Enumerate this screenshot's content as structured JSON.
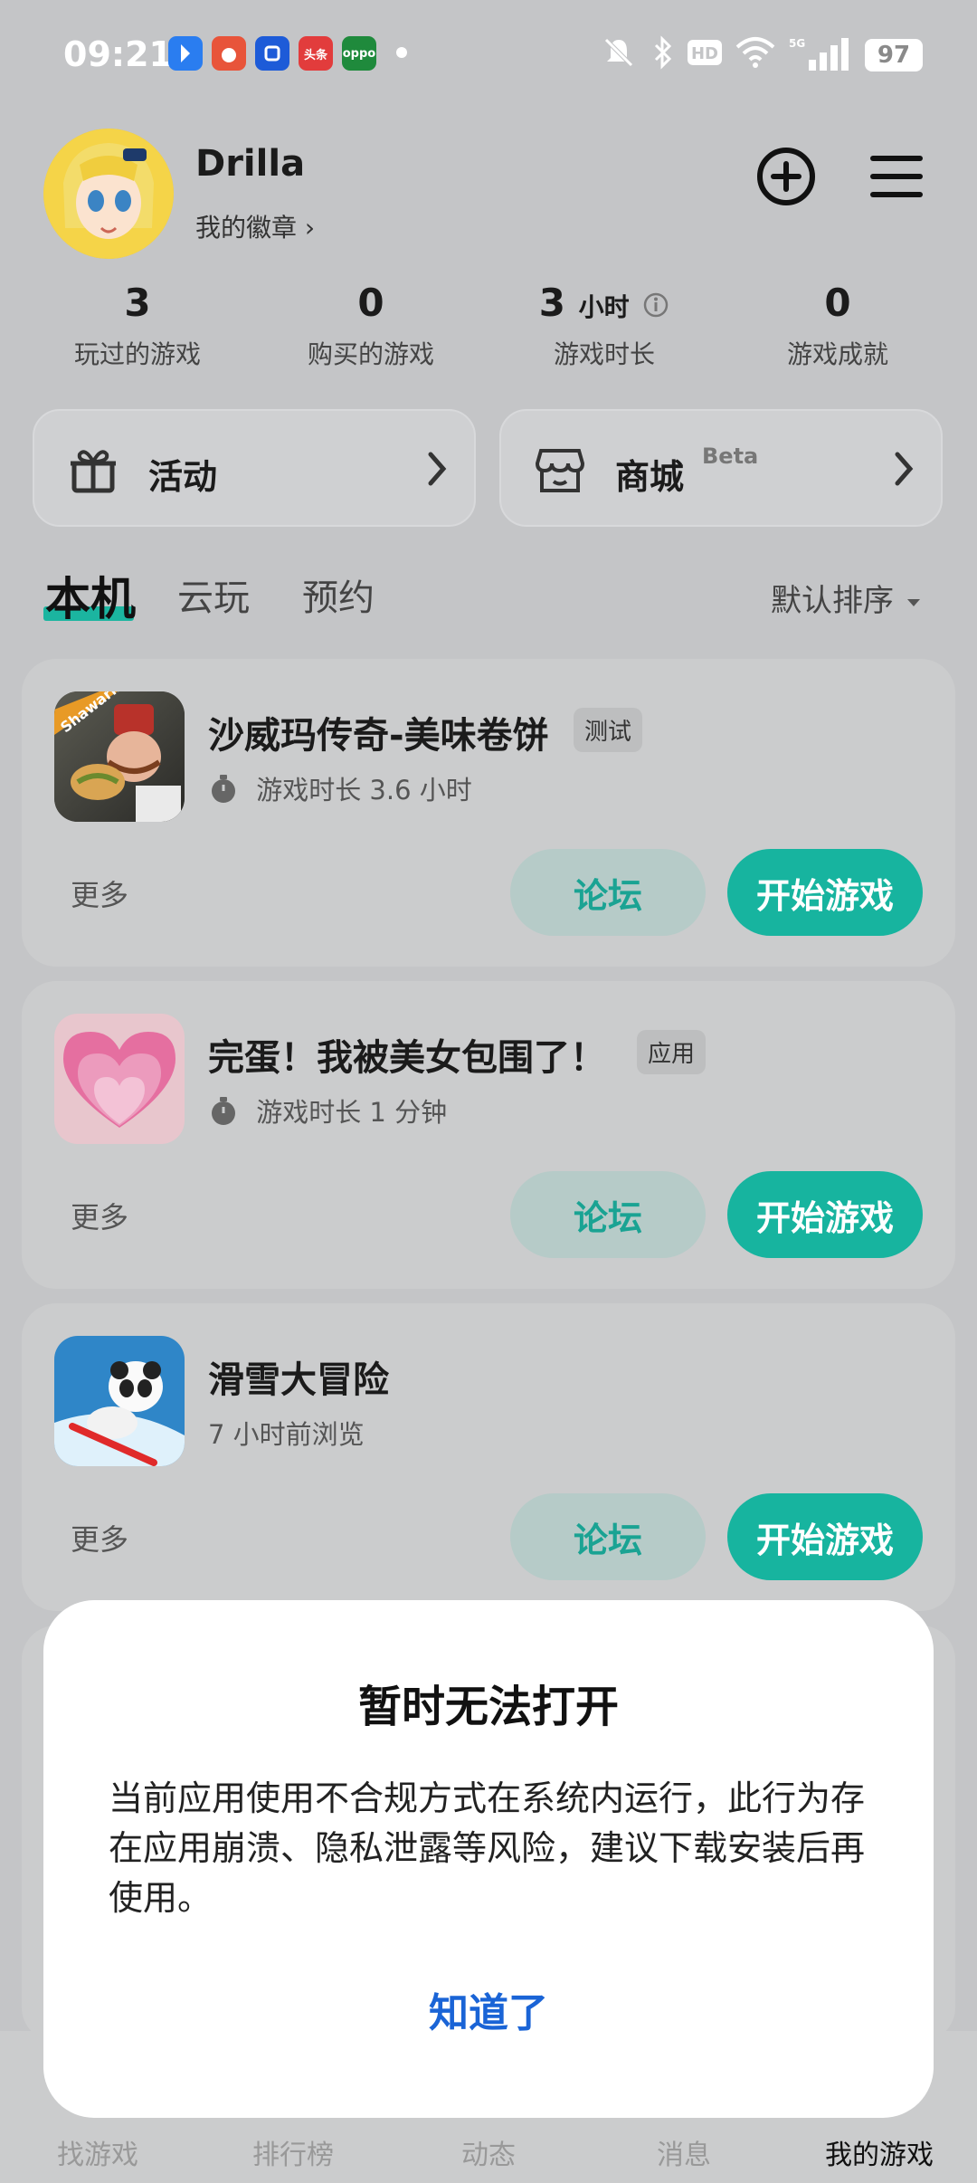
{
  "status_bar": {
    "time": "09:21",
    "battery": "97",
    "notif_apps": [
      {
        "name": "app-notif-1",
        "color": "#2a7df0",
        "text": ""
      },
      {
        "name": "app-notif-2",
        "color": "#e8543a",
        "text": ""
      },
      {
        "name": "app-notif-3",
        "color": "#1d5bd8",
        "text": ""
      },
      {
        "name": "toutiao-notif",
        "color": "#e23c3c",
        "text": "头条"
      },
      {
        "name": "oppo-notif",
        "color": "#1f8a3c",
        "text": "oppo"
      }
    ]
  },
  "profile": {
    "username": "Drilla",
    "badge_link": "我的徽章 ›"
  },
  "stats": [
    {
      "value": "3",
      "unit": "",
      "label": "玩过的游戏"
    },
    {
      "value": "0",
      "unit": "",
      "label": "购买的游戏"
    },
    {
      "value": "3",
      "unit": "小时",
      "label": "游戏时长"
    },
    {
      "value": "0",
      "unit": "",
      "label": "游戏成就"
    }
  ],
  "quick_links": {
    "activity": "活动",
    "store": "商城",
    "store_badge": "Beta"
  },
  "tabs": {
    "local": "本机",
    "cloud": "云玩",
    "reserve": "预约",
    "sort": "默认排序"
  },
  "games": [
    {
      "title": "沙威玛传奇-美味卷饼",
      "tag": "测试",
      "sub": "游戏时长 3.6 小时",
      "timer": true,
      "more": "更多",
      "forum": "论坛",
      "start": "开始游戏"
    },
    {
      "title": "完蛋！我被美女包围了！",
      "tag": "应用",
      "sub": "游戏时长 1 分钟",
      "timer": true,
      "more": "更多",
      "forum": "论坛",
      "start": "开始游戏"
    },
    {
      "title": "滑雪大冒险",
      "tag": "",
      "sub": "7 小时前浏览",
      "timer": false,
      "more": "更多",
      "forum": "论坛",
      "start": "开始游戏"
    }
  ],
  "game_icon_texts": {
    "shawarma_logo": "Shawarma"
  },
  "bottom_nav": [
    "找游戏",
    "排行榜",
    "动态",
    "消息",
    "我的游戏"
  ],
  "dialog": {
    "title": "暂时无法打开",
    "body": "当前应用使用不合规方式在系统内运行，此行为存在应用崩溃、隐私泄露等风险，建议下载安装后再使用。",
    "confirm": "知道了"
  },
  "colors": {
    "accent": "#17b49f",
    "dialog_link": "#1a64d6"
  }
}
